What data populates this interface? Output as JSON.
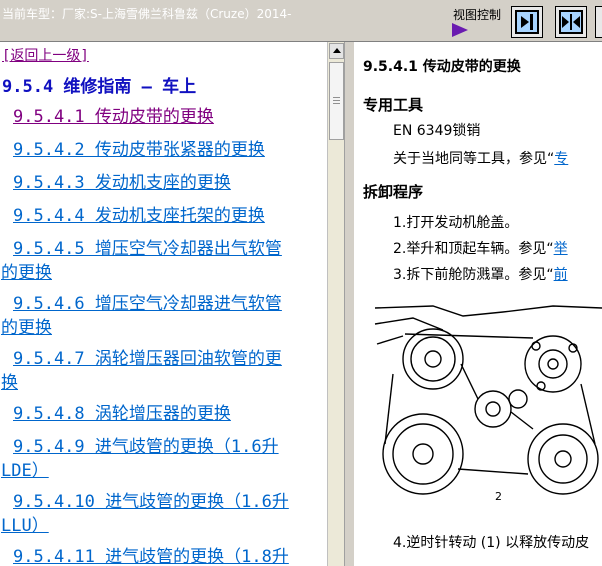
{
  "topbar": {
    "vehicle_label": "当前车型：厂家:S-上海雪佛兰科鲁兹（Cruze）2014-",
    "view_control_label": "视图控制"
  },
  "left_pane": {
    "back_link": "[返回上一级]",
    "section_title": "9.5.4  维修指南 – 车上",
    "toc": [
      {
        "line1": "9.5.4.1  传动皮带的更换",
        "line2": "",
        "visited": true
      },
      {
        "line1": "9.5.4.2  传动皮带张紧器的更换",
        "line2": "",
        "visited": false
      },
      {
        "line1": "9.5.4.3  发动机支座的更换",
        "line2": "",
        "visited": false
      },
      {
        "line1": "9.5.4.4  发动机支座托架的更换",
        "line2": "",
        "visited": false
      },
      {
        "line1": "9.5.4.5  增压空气冷却器出气软管",
        "line2": "的更换",
        "visited": false
      },
      {
        "line1": "9.5.4.6  增压空气冷却器进气软管",
        "line2": "的更换",
        "visited": false
      },
      {
        "line1": "9.5.4.7  涡轮增压器回油软管的更",
        "line2": "换",
        "visited": false
      },
      {
        "line1": "9.5.4.8  涡轮增压器的更换",
        "line2": "",
        "visited": false
      },
      {
        "line1": "9.5.4.9  进气歧管的更换（1.6升",
        "line2": "LDE）",
        "visited": false
      },
      {
        "line1": "9.5.4.10  进气歧管的更换（1.6升",
        "line2": "LLU）",
        "visited": false
      },
      {
        "line1": "9.5.4.11  进气歧管的更换（1.8升",
        "line2": "",
        "visited": false
      }
    ]
  },
  "right_pane": {
    "heading": "9.5.4.1  传动皮带的更换",
    "special_tools_heading": "专用工具",
    "tool_line": "EN 6349锁销",
    "equiv_tools_prefix": "关于当地同等工具，参见“",
    "equiv_tools_link": "专",
    "removal_heading": "拆卸程序",
    "steps": [
      {
        "text": "1.打开发动机舱盖。",
        "link": ""
      },
      {
        "text": "2.举升和顶起车辆。参见“",
        "link": "举"
      },
      {
        "text": "3.拆下前舱防溅罩。参见“",
        "link": "前"
      }
    ],
    "figure_label": "2",
    "step4_text": "4.逆时针转动 (1) 以释放传动皮"
  },
  "colors": {
    "link": "#0066cc",
    "visited_link": "#800080",
    "section_title": "#1010c0",
    "toolbar_bg": "#d4d0c8"
  }
}
